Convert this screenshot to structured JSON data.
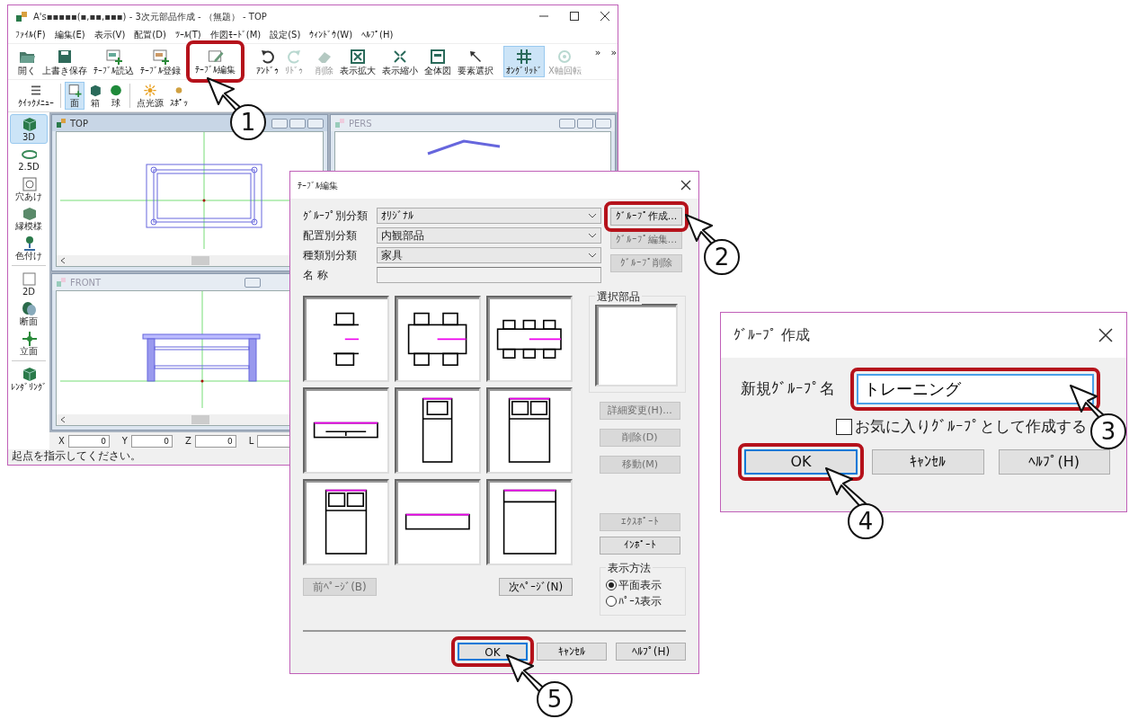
{
  "main_window": {
    "title": "A's▪▪▪▪▪(▪,▪▪,▪▪▪) - 3次元部品作成 - （無題） - TOP",
    "menu": [
      "ﾌｧｲﾙ(F)",
      "編集(E)",
      "表示(V)",
      "配置(D)",
      "ﾂｰﾙ(T)",
      "作図ﾓｰﾄﾞ(M)",
      "設定(S)",
      "ｳｨﾝﾄﾞｳ(W)",
      "ﾍﾙﾌﾟ(H)"
    ],
    "toolbar_rows": [
      {
        "overflow": [
          "»",
          "»"
        ],
        "items": [
          {
            "label": "開く",
            "kind": "folder",
            "selected": false,
            "disabled": false,
            "highlighted": false
          },
          {
            "label": "上書き保存",
            "kind": "save",
            "selected": false,
            "disabled": false,
            "highlighted": false
          },
          {
            "label": "ﾃｰﾌﾞﾙ読込",
            "kind": "import",
            "selected": false,
            "disabled": false,
            "highlighted": false
          },
          {
            "label": "ﾃｰﾌﾞﾙ登録",
            "kind": "register",
            "selected": false,
            "disabled": false,
            "highlighted": false
          },
          {
            "label": "ﾃｰﾌﾞﾙ編集",
            "kind": "edit",
            "selected": false,
            "disabled": false,
            "highlighted": true
          },
          {
            "label": "ｱﾝﾄﾞｩ",
            "kind": "undo",
            "selected": false,
            "disabled": false,
            "highlighted": false
          },
          {
            "label": "ﾘﾄﾞｩ",
            "kind": "redo",
            "selected": false,
            "disabled": true,
            "highlighted": false
          },
          {
            "label": "削除",
            "kind": "eraser",
            "selected": false,
            "disabled": true,
            "highlighted": false
          },
          {
            "label": "表示拡大",
            "kind": "zoomin",
            "selected": false,
            "disabled": false,
            "highlighted": false
          },
          {
            "label": "表示縮小",
            "kind": "zoomout",
            "selected": false,
            "disabled": false,
            "highlighted": false
          },
          {
            "label": "全体図",
            "kind": "fit",
            "selected": false,
            "disabled": false,
            "highlighted": false
          },
          {
            "label": "要素選択",
            "kind": "pointer",
            "selected": false,
            "disabled": false,
            "highlighted": false
          },
          {
            "label": "ｵﾝｸﾞﾘｯﾄﾞ",
            "kind": "grid",
            "selected": true,
            "disabled": false,
            "highlighted": false
          },
          {
            "label": "X軸回転",
            "kind": "rotate",
            "selected": false,
            "disabled": true,
            "highlighted": false
          }
        ]
      },
      {
        "overflow": [],
        "items": [
          {
            "label": "ｸｲｯｸﾒﾆｭｰ",
            "kind": "menu",
            "selected": false,
            "disabled": false,
            "highlighted": false
          },
          {
            "label": "面",
            "kind": "face",
            "selected": true,
            "disabled": false,
            "highlighted": false
          },
          {
            "label": "箱",
            "kind": "box",
            "selected": false,
            "disabled": false,
            "highlighted": false
          },
          {
            "label": "球",
            "kind": "sphere",
            "selected": false,
            "disabled": false,
            "highlighted": false
          },
          {
            "label": "点光源",
            "kind": "light",
            "selected": false,
            "disabled": false,
            "highlighted": false
          },
          {
            "label": "ｽﾎﾟｯ",
            "kind": "spot",
            "selected": false,
            "disabled": false,
            "highlighted": false
          }
        ]
      }
    ],
    "sidebar_groups": [
      [
        {
          "label": "3D",
          "kind": "cube",
          "selected": true
        },
        {
          "label": "2.5D",
          "kind": "ring",
          "selected": false
        },
        {
          "label": "穴あけ",
          "kind": "hole",
          "selected": false
        },
        {
          "label": "縁模様",
          "kind": "frame",
          "selected": false
        },
        {
          "label": "色付け",
          "kind": "paint",
          "selected": false
        }
      ],
      [
        {
          "label": "2D",
          "kind": "square",
          "selected": false
        },
        {
          "label": "断面",
          "kind": "section",
          "selected": false
        },
        {
          "label": "立面",
          "kind": "move",
          "selected": false
        }
      ],
      [
        {
          "label": "ﾚﾝﾀﾞﾘﾝｸﾞ",
          "kind": "cube",
          "selected": false
        }
      ]
    ],
    "viewports": [
      {
        "title": "TOP",
        "active": true,
        "kind": "top"
      },
      {
        "title": "PERS",
        "active": false,
        "kind": "pers"
      },
      {
        "title": "FRONT",
        "active": false,
        "kind": "front"
      }
    ],
    "coordinates": [
      {
        "label": "X",
        "value": "0"
      },
      {
        "label": "Y",
        "value": "0"
      },
      {
        "label": "Z",
        "value": "0"
      },
      {
        "label": "L"
      }
    ],
    "status_bar": "起点を指示してください。"
  },
  "table_dialog": {
    "title": "ﾃｰﾌﾞﾙ編集",
    "fields": [
      {
        "label": "ｸﾞﾙｰﾌﾟ別分類",
        "kind": "select",
        "value": "ｵﾘｼﾞﾅﾙ"
      },
      {
        "label": "配置別分類",
        "kind": "select",
        "value": "内観部品"
      },
      {
        "label": "種類別分類",
        "kind": "select",
        "value": "家具"
      },
      {
        "label": "名 称",
        "kind": "text"
      }
    ],
    "group_buttons": [
      {
        "label": "ｸﾞﾙｰﾌﾟ作成...",
        "disabled": false,
        "highlighted": true
      },
      {
        "label": "ｸﾞﾙｰﾌﾟ編集...",
        "disabled": true,
        "highlighted": false
      },
      {
        "label": "ｸﾞﾙｰﾌﾟ削除",
        "disabled": true,
        "highlighted": false
      }
    ],
    "thumbnails": [
      {
        "kind": "table2"
      },
      {
        "kind": "table4"
      },
      {
        "kind": "table6"
      },
      {
        "kind": "desk"
      },
      {
        "kind": "single"
      },
      {
        "kind": "double"
      },
      {
        "kind": "double"
      },
      {
        "kind": "bench"
      },
      {
        "kind": "mattress"
      }
    ],
    "selection_label": "選択部品",
    "part_buttons": [
      {
        "label": "詳細変更(H)...",
        "disabled": true
      },
      {
        "label": "削除(D)",
        "disabled": true
      },
      {
        "label": "移動(M)",
        "disabled": true
      }
    ],
    "io_buttons": [
      {
        "label": "ｴｸｽﾎﾟｰﾄ",
        "disabled": true
      },
      {
        "label": "ｲﾝﾎﾟｰﾄ",
        "disabled": false
      }
    ],
    "display_mode": {
      "label": "表示方法",
      "options": [
        {
          "label": "平面表示",
          "selected": true
        },
        {
          "label": "ﾊﾟｰｽ表示",
          "selected": false
        }
      ]
    },
    "page_buttons": [
      {
        "label": "前ﾍﾟｰｼﾞ(B)",
        "disabled": true
      },
      {
        "label": "次ﾍﾟｰｼﾞ(N)",
        "disabled": false
      }
    ],
    "footer_buttons": [
      {
        "label": "OK",
        "default": true,
        "highlighted": true
      },
      {
        "label": "ｷｬﾝｾﾙ",
        "default": false,
        "highlighted": false
      },
      {
        "label": "ﾍﾙﾌﾟ(H)",
        "default": false,
        "highlighted": false
      }
    ]
  },
  "group_dialog": {
    "title": "ｸﾞﾙｰﾌﾟ 作成",
    "name_label": "新規ｸﾞﾙｰﾌﾟ名",
    "name_value": "トレーニング",
    "name_highlighted": true,
    "favorite": {
      "label": "お気に入りｸﾞﾙｰﾌﾟとして作成する",
      "checked": false
    },
    "buttons": [
      {
        "label": "OK",
        "default": true,
        "highlighted": true
      },
      {
        "label": "ｷｬﾝｾﾙ",
        "default": false,
        "highlighted": false
      },
      {
        "label": "ﾍﾙﾌﾟ(H)",
        "default": false,
        "highlighted": false
      }
    ]
  },
  "callouts": [
    {
      "number": "1"
    },
    {
      "number": "2"
    },
    {
      "number": "3"
    },
    {
      "number": "4"
    },
    {
      "number": "5"
    }
  ]
}
